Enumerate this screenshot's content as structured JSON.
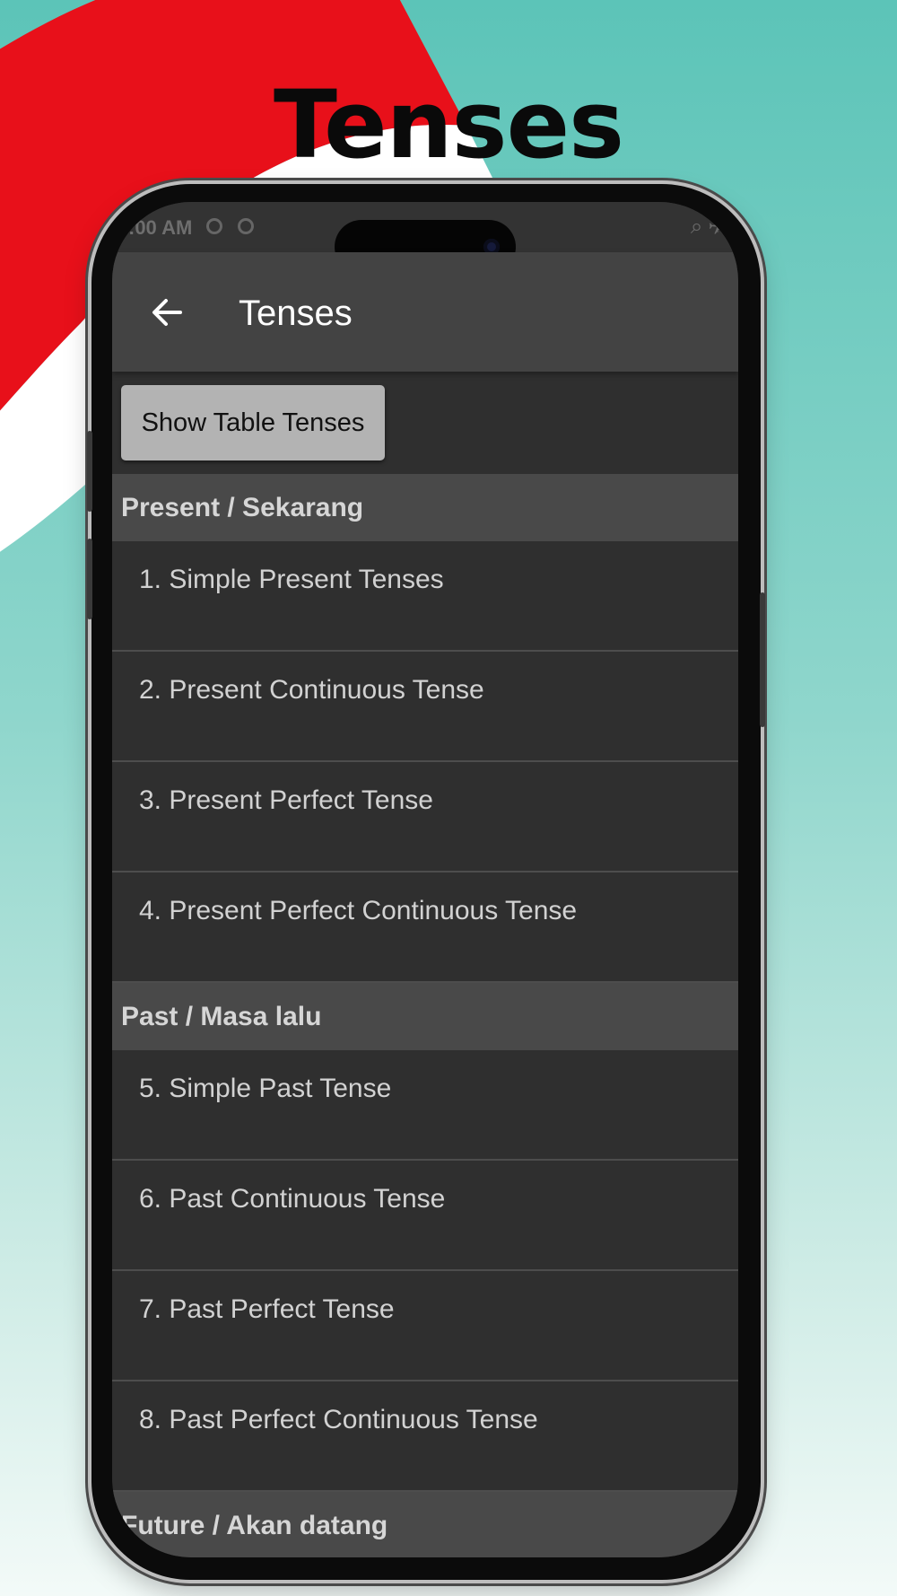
{
  "promo": {
    "title": "Tenses"
  },
  "status_bar": {
    "time": ":00 AM",
    "right_icons": "⌕ ✈"
  },
  "app_bar": {
    "title": "Tenses",
    "back_icon": "arrow-left-icon"
  },
  "actions": {
    "show_table_label": "Show Table Tenses"
  },
  "sections": [
    {
      "header": "Present / Sekarang",
      "items": [
        "1. Simple Present Tenses",
        "2. Present Continuous Tense",
        "3. Present Perfect Tense",
        "4. Present Perfect Continuous Tense"
      ]
    },
    {
      "header": "Past / Masa lalu",
      "items": [
        "5. Simple Past Tense",
        "6. Past Continuous Tense",
        "7. Past Perfect Tense",
        "8. Past Perfect Continuous Tense"
      ]
    },
    {
      "header": "Future / Akan datang",
      "items": []
    }
  ],
  "colors": {
    "flag_red": "#e8101a",
    "flag_white": "#ffffff",
    "app_bar": "#434343",
    "list_bg": "#2f2f2f",
    "section_bg": "#494949"
  }
}
